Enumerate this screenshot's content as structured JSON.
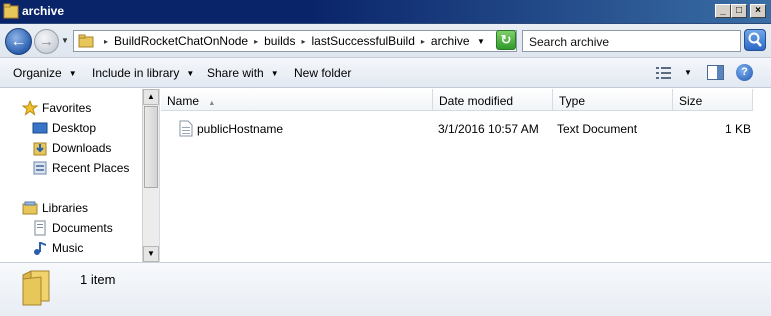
{
  "window": {
    "title": "archive",
    "minimize": "_",
    "maximize": "□",
    "close": "×"
  },
  "address": {
    "crumbs": [
      "BuildRocketChatOnNode",
      "builds",
      "lastSuccessfulBuild",
      "archive"
    ],
    "search_placeholder": "Search archive"
  },
  "toolbar": {
    "organize": "Organize",
    "include_in_library": "Include in library",
    "share_with": "Share with",
    "new_folder": "New folder"
  },
  "nav": {
    "favorites": "Favorites",
    "desktop": "Desktop",
    "downloads": "Downloads",
    "recent_places": "Recent Places",
    "libraries": "Libraries",
    "documents": "Documents",
    "music": "Music"
  },
  "columns": {
    "name": "Name",
    "date_modified": "Date modified",
    "type": "Type",
    "size": "Size"
  },
  "files": [
    {
      "name": "publicHostname",
      "date_modified": "3/1/2016 10:57 AM",
      "type": "Text Document",
      "size": "1 KB"
    }
  ],
  "status": {
    "item_count": "1 item"
  },
  "colors": {
    "titlebar": "#0a246a",
    "accent": "#2a5fae"
  }
}
